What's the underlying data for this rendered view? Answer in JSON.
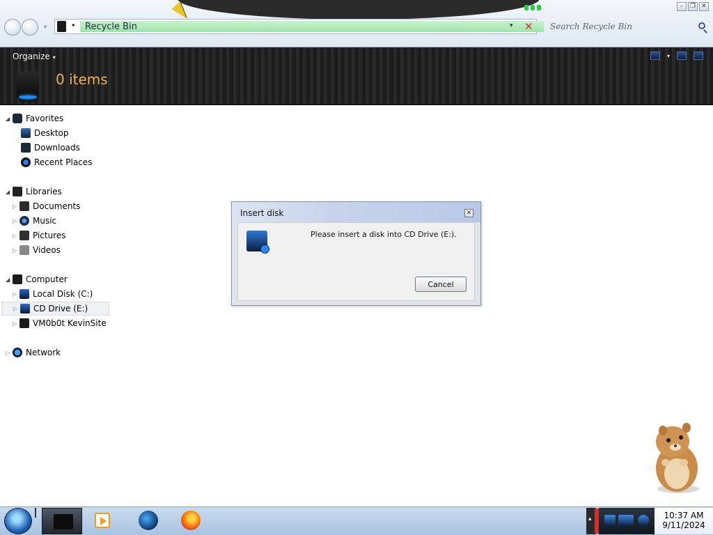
{
  "window": {
    "controls": {
      "minimize": "–",
      "restore": "❐",
      "close": "✕"
    }
  },
  "address_bar": {
    "path_separator": "•",
    "location": "Recycle Bin",
    "dropdown_glyph": "▾",
    "clear_glyph": "✕"
  },
  "search": {
    "placeholder": "Search Recycle Bin"
  },
  "toolbar": {
    "organize_label": "Organize",
    "organize_arrow": "▾",
    "view_dropdown": "▾"
  },
  "header": {
    "item_count": "0 items"
  },
  "nav": {
    "expanded_glyph": "◢",
    "collapsed_glyph": "▷",
    "favorites": {
      "label": "Favorites",
      "items": [
        {
          "label": "Desktop"
        },
        {
          "label": "Downloads"
        },
        {
          "label": "Recent Places"
        }
      ]
    },
    "libraries": {
      "label": "Libraries",
      "items": [
        {
          "label": "Documents"
        },
        {
          "label": "Music"
        },
        {
          "label": "Pictures"
        },
        {
          "label": "Videos"
        }
      ]
    },
    "computer": {
      "label": "Computer",
      "items": [
        {
          "label": "Local Disk (C:)"
        },
        {
          "label": "CD Drive (E:)"
        },
        {
          "label": "VM0b0t KevinSite"
        }
      ]
    },
    "network": {
      "label": "Network"
    }
  },
  "dialog": {
    "title": "Insert disk",
    "close_glyph": "✕",
    "message": "Please insert a disk into CD Drive (E:).",
    "cancel_label": "Cancel"
  },
  "taskbar": {
    "tray_expand": "▴",
    "clock": {
      "time": "10:37 AM",
      "date": "9/11/2024"
    }
  },
  "colors": {
    "header_bg": "#1f1f1f",
    "item_count": "#f0b24a",
    "address_fill": "#a9e6b2",
    "clear_x": "#d0342c",
    "taskbar_bg": "#b9d0ea"
  }
}
